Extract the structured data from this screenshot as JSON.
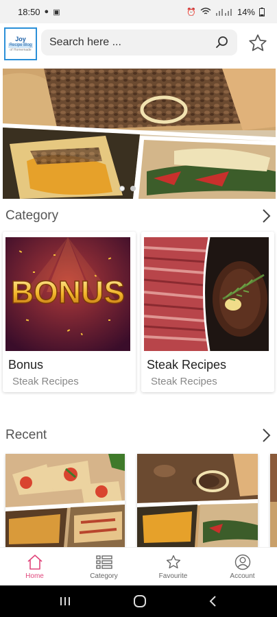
{
  "status_bar": {
    "time": "18:50",
    "battery": "14%"
  },
  "logo": {
    "line1": "Joy",
    "line2": "Recipe Blog",
    "line3": "of Homemade"
  },
  "search": {
    "placeholder": "Search here ..."
  },
  "sections": {
    "category_title": "Category",
    "recent_title": "Recent"
  },
  "categories": [
    {
      "name": "Bonus",
      "subtitle": "Steak Recipes",
      "image_text": "BONUS"
    },
    {
      "name": "Steak Recipes",
      "subtitle": "Steak Recipes"
    }
  ],
  "bottom_nav": [
    {
      "label": "Home",
      "icon": "home-icon",
      "active": true
    },
    {
      "label": "Category",
      "icon": "list-icon",
      "active": false
    },
    {
      "label": "Favourite",
      "icon": "star-icon",
      "active": false
    },
    {
      "label": "Account",
      "icon": "account-icon",
      "active": false
    }
  ],
  "colors": {
    "accent": "#e0457b",
    "search_bg": "#f1f1f1",
    "nav_bar": "#000000"
  }
}
